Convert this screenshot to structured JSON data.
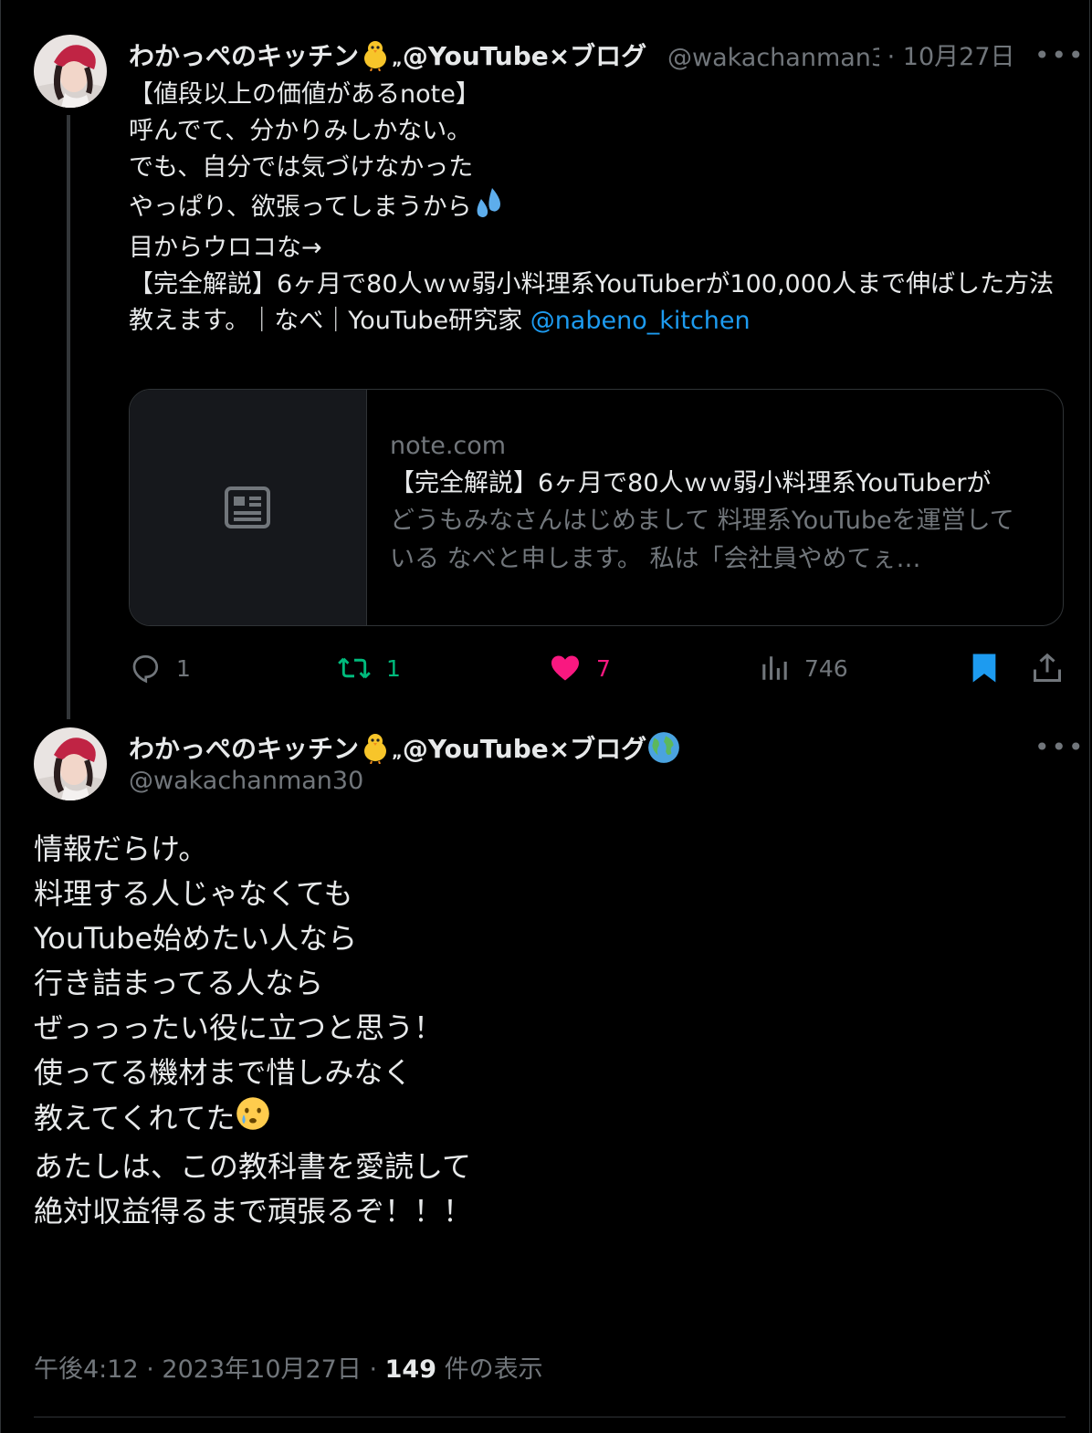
{
  "tweet1": {
    "author_name": "わかっぺのキッチン",
    "author_name_suffix": "@YouTube×ブログ",
    "handle": "@wakachanman3",
    "separator": "·",
    "date": "10月27日",
    "more_label": "•••",
    "text_lines": [
      "【値段以上の価値があるnote】",
      "呼んでて、分かりみしかない。",
      "でも、自分では気づけなかった",
      "やっぱり、欲張ってしまうから",
      "目からウロコな→",
      "",
      "【完全解説】6ヶ月で80人ｗｗ弱小料理系YouTuberが100,000人まで伸ばした方法教えます。｜なべ｜YouTube研究家 "
    ],
    "mention": "@nabeno_kitchen",
    "card": {
      "domain": "note.com",
      "title": "【完全解説】6ヶ月で80人ｗｗ弱小料理系YouTuberが",
      "description": "どうもみなさんはじめまして 料理系YouTubeを運営している なべと申します。 私は「会社員やめてぇ…",
      "thumb_icon": "newspaper-icon"
    },
    "actions": {
      "reply": "1",
      "retweet": "1",
      "like": "7",
      "views": "746"
    },
    "colors": {
      "retweet": "#00ba7c",
      "like": "#f91880",
      "bookmark": "#1d9bf0",
      "mention": "#1d9bf0"
    }
  },
  "tweet2": {
    "author_name": "わかっぺのキッチン",
    "author_name_suffix": "@YouTube×ブログ",
    "handle": "@wakachanman30",
    "more_label": "•••",
    "text_lines": [
      "情報だらけ。",
      "料理する人じゃなくても",
      "YouTube始めたい人なら",
      "行き詰まってる人なら",
      "ぜっっったい役に立つと思う！",
      "",
      "使ってる機材まで惜しみなく",
      "教えてくれてた",
      "",
      "あたしは、この教科書を愛読して",
      "絶対収益得るまで頑張るぞ！！！"
    ],
    "footer": {
      "time": "午後4:12",
      "sep1": "·",
      "date": "2023年10月27日",
      "sep2": "·",
      "views_count": "149",
      "views_label": "件の表示"
    }
  }
}
